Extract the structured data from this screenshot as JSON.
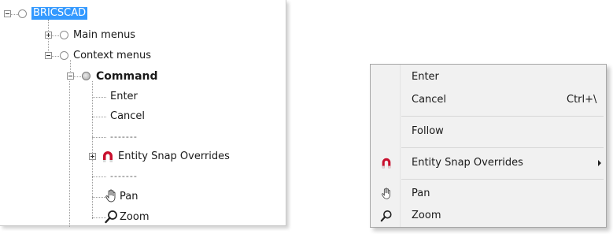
{
  "tree": {
    "root_label": "BRICSCAD",
    "items": {
      "main_menus": "Main menus",
      "context_menus": "Context menus",
      "command": "Command",
      "enter": "Enter",
      "cancel": "Cancel",
      "separator_1": "-------",
      "entity_snap": "Entity Snap Overrides",
      "separator_2": "-------",
      "pan": "Pan",
      "zoom": "Zoom"
    }
  },
  "context_menu": {
    "items": [
      {
        "label": "Enter",
        "shortcut": "",
        "icon": ""
      },
      {
        "label": "Cancel",
        "shortcut": "Ctrl+\\",
        "icon": ""
      },
      {
        "label": "Follow",
        "shortcut": "",
        "icon": ""
      },
      {
        "label": "Entity Snap Overrides",
        "shortcut": "",
        "icon": "magnet-icon",
        "submenu": true
      },
      {
        "label": "Pan",
        "shortcut": "",
        "icon": "hand-icon"
      },
      {
        "label": "Zoom",
        "shortcut": "",
        "icon": "magnifier-icon"
      }
    ]
  },
  "colors": {
    "selection": "#3399ff",
    "magnet": "#c8102e"
  }
}
